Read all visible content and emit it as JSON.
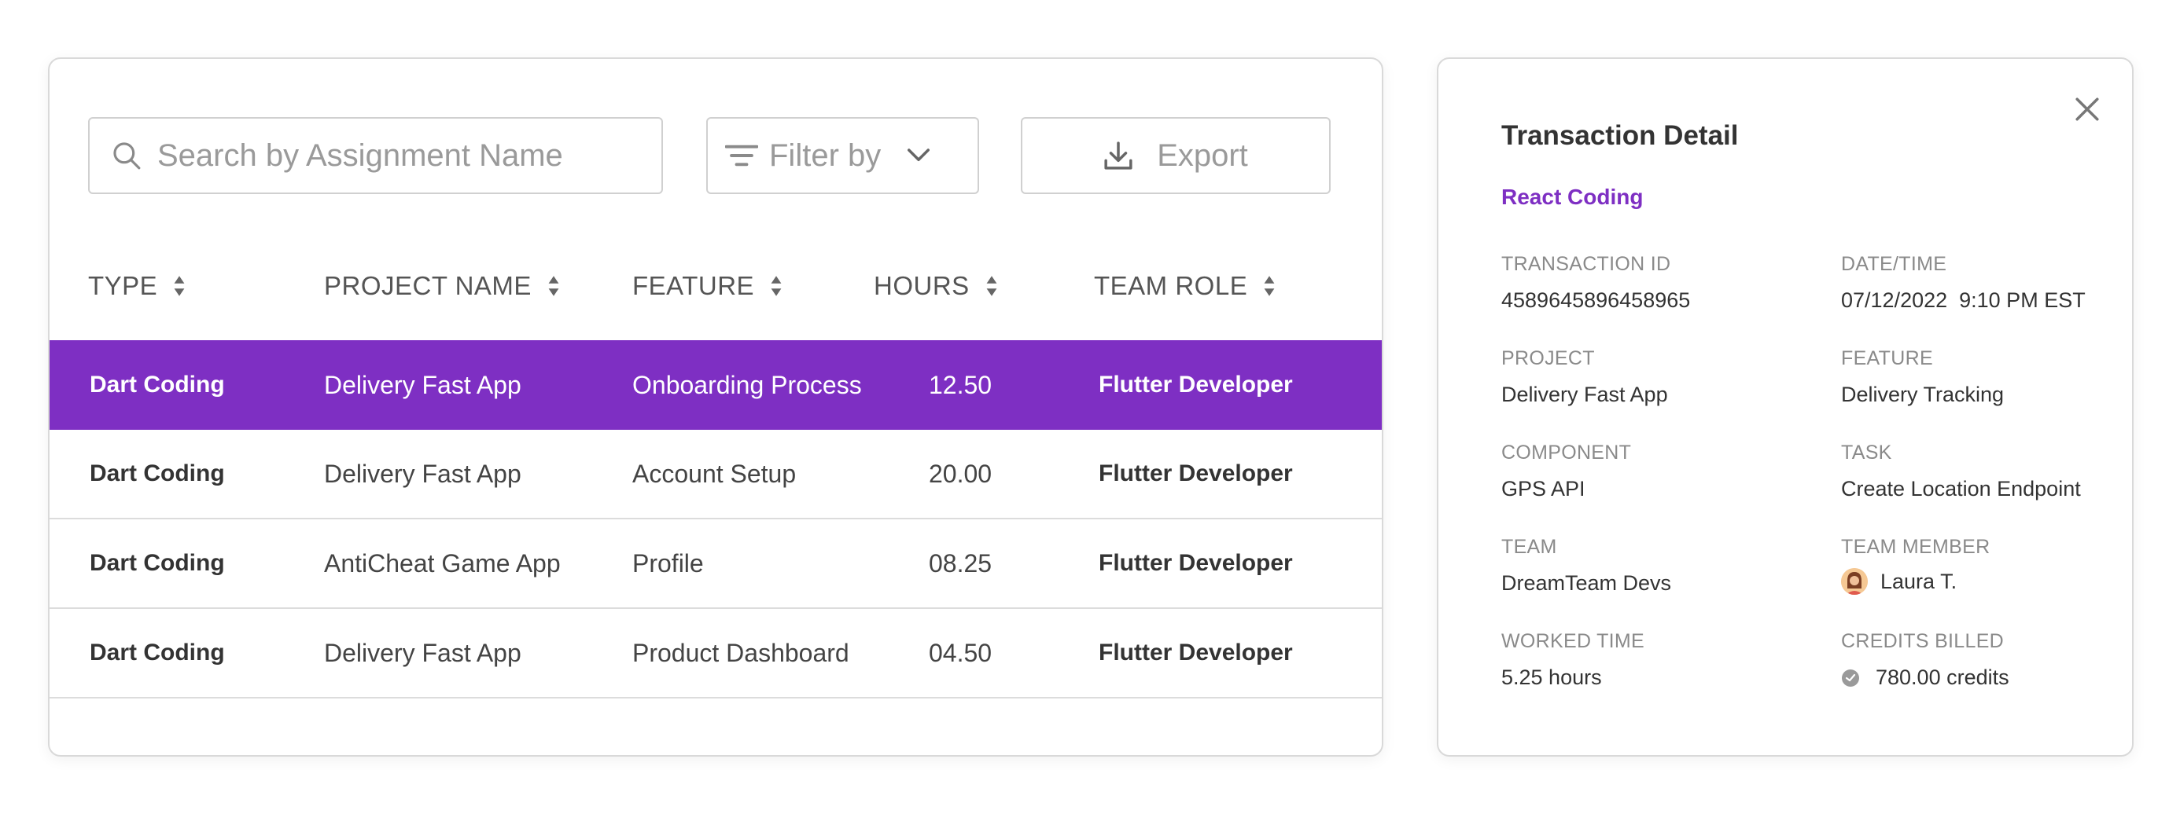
{
  "toolbar": {
    "search_placeholder": "Search by Assignment Name",
    "filter_label": "Filter by",
    "export_label": "Export"
  },
  "table": {
    "columns": [
      "TYPE",
      "PROJECT NAME",
      "FEATURE",
      "HOURS",
      "TEAM ROLE"
    ],
    "rows": [
      {
        "type": "Dart Coding",
        "project": "Delivery Fast App",
        "feature": "Onboarding Process",
        "hours": "12.50",
        "role": "Flutter Developer",
        "selected": true
      },
      {
        "type": "Dart Coding",
        "project": "Delivery Fast App",
        "feature": "Account Setup",
        "hours": "20.00",
        "role": "Flutter Developer"
      },
      {
        "type": "Dart Coding",
        "project": "AntiCheat Game App",
        "feature": "Profile",
        "hours": "08.25",
        "role": "Flutter Developer"
      },
      {
        "type": "Dart Coding",
        "project": "Delivery Fast App",
        "feature": "Product Dashboard",
        "hours": "04.50",
        "role": "Flutter Developer"
      }
    ]
  },
  "detail": {
    "title": "Transaction Detail",
    "subtitle": "React Coding",
    "fields": {
      "transaction_id": {
        "label": "TRANSACTION ID",
        "value": "4589645896458965"
      },
      "datetime": {
        "label": "DATE/TIME",
        "value": "07/12/2022  9:10 PM EST"
      },
      "project": {
        "label": "PROJECT",
        "value": "Delivery Fast App"
      },
      "feature": {
        "label": "FEATURE",
        "value": "Delivery Tracking"
      },
      "component": {
        "label": "COMPONENT",
        "value": "GPS API"
      },
      "task": {
        "label": "TASK",
        "value": "Create Location Endpoint"
      },
      "team": {
        "label": "TEAM",
        "value": "DreamTeam Devs"
      },
      "team_member": {
        "label": "TEAM MEMBER",
        "value": "Laura T."
      },
      "worked_time": {
        "label": "WORKED TIME",
        "value": "5.25 hours"
      },
      "credits_billed": {
        "label": "CREDITS BILLED",
        "value": "780.00 credits"
      }
    }
  },
  "colors": {
    "accent": "#7e2fc3",
    "border": "#d9d9d9",
    "muted_text": "#8a8a8a"
  }
}
